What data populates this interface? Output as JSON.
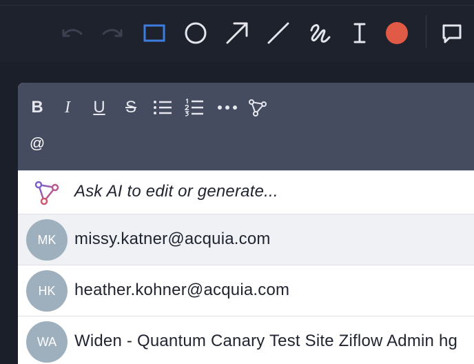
{
  "toolbar": {
    "tools": [
      {
        "name": "undo"
      },
      {
        "name": "redo"
      },
      {
        "name": "rectangle",
        "active": true
      },
      {
        "name": "ellipse"
      },
      {
        "name": "arrow"
      },
      {
        "name": "line"
      },
      {
        "name": "freehand"
      },
      {
        "name": "text"
      },
      {
        "name": "color"
      },
      {
        "name": "comment"
      }
    ],
    "active_color": "#e05a45",
    "highlight_color": "#3d7fe0"
  },
  "editor": {
    "format_buttons": {
      "bold": "B",
      "italic": "I",
      "underline": "U",
      "strikethrough": "S",
      "mention": "@"
    },
    "ai_prompt": "Ask AI to edit or generate...",
    "mentions": [
      {
        "initials": "MK",
        "label": "missy.katner@acquia.com"
      },
      {
        "initials": "HK",
        "label": "heather.kohner@acquia.com"
      },
      {
        "initials": "WA",
        "label": "Widen - Quantum Canary Test Site Ziflow Admin hg"
      }
    ]
  }
}
